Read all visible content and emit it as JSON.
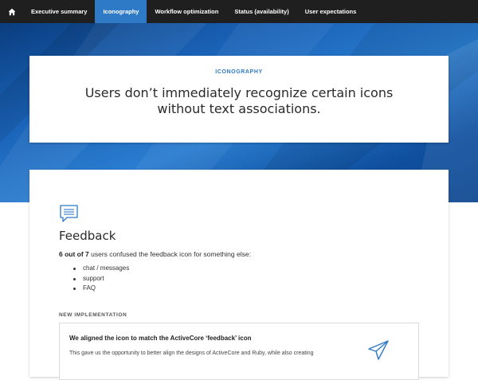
{
  "nav": {
    "home_icon": "home-icon",
    "tabs": [
      {
        "label": "Executive summary",
        "active": false
      },
      {
        "label": "Iconography",
        "active": true
      },
      {
        "label": "Workflow optimization",
        "active": false
      },
      {
        "label": "Status (availability)",
        "active": false
      },
      {
        "label": "User expectations",
        "active": false
      }
    ]
  },
  "hero": {
    "eyebrow": "ICONOGRAPHY",
    "headline": "Users don’t immediately recognize certain icons without text associations."
  },
  "feedback": {
    "icon": "chat-bubble-icon",
    "title": "Feedback",
    "summary_bold": "6 out of 7",
    "summary_rest": " users confused the feedback icon for something else:",
    "items": [
      "chat / messages",
      "support",
      "FAQ"
    ]
  },
  "implementation": {
    "label": "NEW IMPLEMENTATION",
    "heading": "We aligned the icon to match the ActiveCore ‘feedback’ icon",
    "text": "This gave us the opportunity to better align the designs of ActiveCore and Ruby, while also creating",
    "icon": "paper-plane-icon"
  },
  "colors": {
    "nav_bg": "#1f1f1f",
    "accent": "#2e7ac6",
    "hero_blue": "#1a63b8"
  }
}
